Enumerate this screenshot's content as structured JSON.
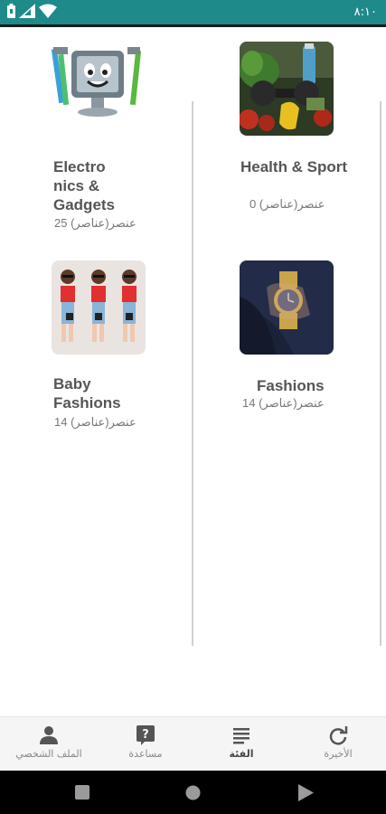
{
  "status_bar": {
    "time": "٨:١٠",
    "icons": [
      "battery-icon",
      "signal-icon",
      "wifi-icon"
    ]
  },
  "categories": [
    {
      "name": "Health & Sport",
      "count_text": "0 عنصر(عناصر)",
      "image": "health-sport-thumbnail"
    },
    {
      "name": "Electro\nnics &\nGadgets",
      "count_text": "25 عنصر(عناصر)",
      "image": "electronics-thumbnail"
    },
    {
      "name": "Fashions",
      "count_text": "14 عنصر(عناصر)",
      "image": "fashions-thumbnail"
    },
    {
      "name": "Baby\nFashions",
      "count_text": "14 عنصر(عناصر)",
      "image": "baby-fashions-thumbnail"
    }
  ],
  "bottom_nav": {
    "items": [
      {
        "label": "الأخيرة",
        "icon": "refresh-icon",
        "active": false
      },
      {
        "label": "الفئة",
        "icon": "list-icon",
        "active": true
      },
      {
        "label": "مساعدة",
        "icon": "help-icon",
        "active": false
      },
      {
        "label": "الملف الشخصي",
        "icon": "person-icon",
        "active": false
      }
    ]
  },
  "colors": {
    "status_bar": "#1f8a8a",
    "text_title": "#555555",
    "text_count": "#777777",
    "nav_bg": "#f5f5f5"
  }
}
